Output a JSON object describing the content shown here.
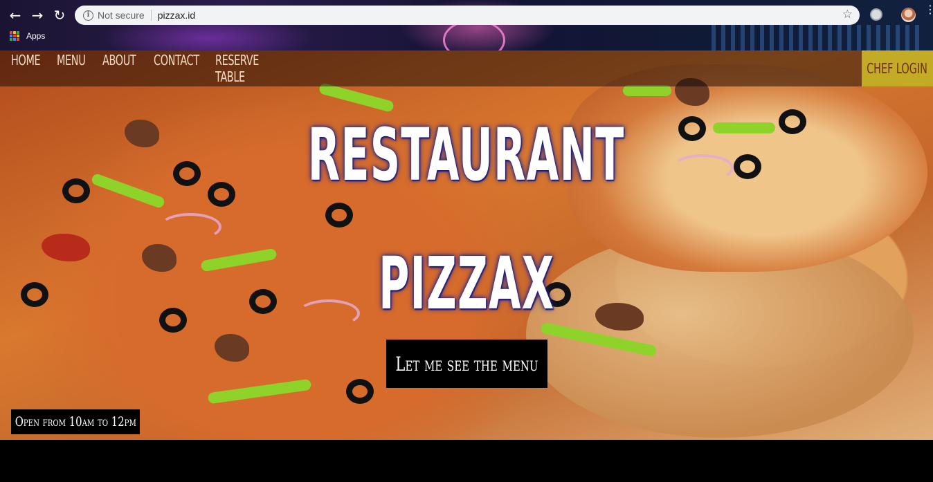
{
  "browser": {
    "back_icon": "back-arrow-icon",
    "forward_icon": "forward-arrow-icon",
    "reload_icon": "reload-icon",
    "security_label": "Not secure",
    "url": "pizzax.id",
    "bookmark_icon": "star-icon",
    "bookmarks": {
      "apps_label": "Apps"
    }
  },
  "nav": {
    "items": [
      {
        "label": "Home"
      },
      {
        "label": "Menu"
      },
      {
        "label": "About"
      },
      {
        "label": "Contact"
      },
      {
        "label": "Reserve Table"
      }
    ],
    "chef_login": "Chef Login"
  },
  "hero": {
    "title_line1": "RESTAURANT",
    "title_line2": "PIZZAX",
    "cta_label": "Let me see the menu",
    "hours": "Open from 10am to 12pm"
  },
  "colors": {
    "nav_text": "#f4dcc8",
    "chef_login_bg": "#d2be28",
    "cta_bg": "#000000",
    "title_glow": "#2a2aa0"
  }
}
